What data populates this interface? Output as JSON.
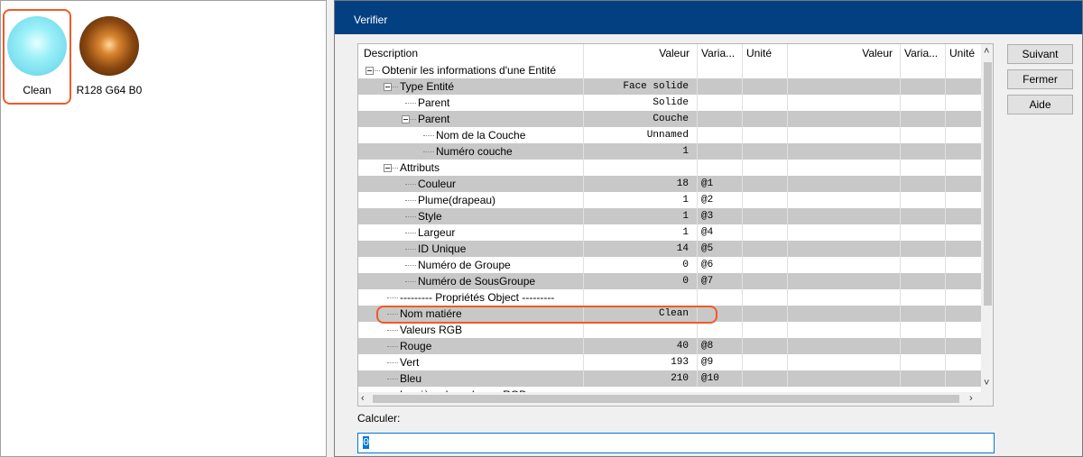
{
  "materials": [
    {
      "label": "Clean",
      "selected": true,
      "color": "#8ee8f4"
    },
    {
      "label": "R128 G64 B0",
      "selected": false,
      "color": "#804000"
    }
  ],
  "dialog": {
    "title": "Verifier",
    "buttons": {
      "next": "Suivant",
      "close": "Fermer",
      "help": "Aide"
    },
    "calc_label": "Calculer:",
    "calc_value": "0"
  },
  "grid": {
    "headers": [
      "Description",
      "Valeur",
      "Varia...",
      "Unité",
      "Valeur",
      "Varia...",
      "Unité"
    ],
    "rows": [
      {
        "desc": "Obtenir les informations d'une Entité",
        "value": "",
        "var": "",
        "level": 0,
        "expander": true
      },
      {
        "desc": "Type Entité",
        "value": "Face solide",
        "var": "",
        "level": 1,
        "expander": true
      },
      {
        "desc": "Parent",
        "value": "Solide",
        "var": "",
        "level": 2,
        "expander": false
      },
      {
        "desc": "Parent",
        "value": "Couche",
        "var": "",
        "level": 2,
        "expander": true
      },
      {
        "desc": "Nom de la Couche",
        "value": "Unnamed",
        "var": "",
        "level": 3,
        "expander": false
      },
      {
        "desc": "Numéro couche",
        "value": "1",
        "var": "",
        "level": 3,
        "expander": false
      },
      {
        "desc": "Attributs",
        "value": "",
        "var": "",
        "level": 1,
        "expander": true
      },
      {
        "desc": "Couleur",
        "value": "18",
        "var": "@1",
        "level": 2,
        "expander": false
      },
      {
        "desc": "Plume(drapeau)",
        "value": "1",
        "var": "@2",
        "level": 2,
        "expander": false
      },
      {
        "desc": "Style",
        "value": "1",
        "var": "@3",
        "level": 2,
        "expander": false
      },
      {
        "desc": "Largeur",
        "value": "1",
        "var": "@4",
        "level": 2,
        "expander": false
      },
      {
        "desc": "ID Unique",
        "value": "14",
        "var": "@5",
        "level": 2,
        "expander": false
      },
      {
        "desc": "Numéro de Groupe",
        "value": "0",
        "var": "@6",
        "level": 2,
        "expander": false
      },
      {
        "desc": "Numéro de SousGroupe",
        "value": "0",
        "var": "@7",
        "level": 2,
        "expander": false
      },
      {
        "desc": "--------- Propriétés Object ---------",
        "value": "",
        "var": "",
        "level": 1,
        "expander": false
      },
      {
        "desc": "Nom matiére",
        "value": "Clean",
        "var": "",
        "level": 1,
        "expander": false
      },
      {
        "desc": "Valeurs RGB",
        "value": "",
        "var": "",
        "level": 1,
        "expander": false
      },
      {
        "desc": "Rouge",
        "value": "40",
        "var": "@8",
        "level": 1,
        "expander": false
      },
      {
        "desc": "Vert",
        "value": "193",
        "var": "@9",
        "level": 1,
        "expander": false
      },
      {
        "desc": "Bleu",
        "value": "210",
        "var": "@10",
        "level": 1,
        "expander": false
      },
      {
        "desc": "Lumière de ombrage RGB",
        "value": "",
        "var": "",
        "level": 1,
        "expander": false
      }
    ]
  },
  "colors": {
    "titlebar": "#034081",
    "highlight": "#f05a28",
    "row_gray": "#c8c8c8"
  }
}
